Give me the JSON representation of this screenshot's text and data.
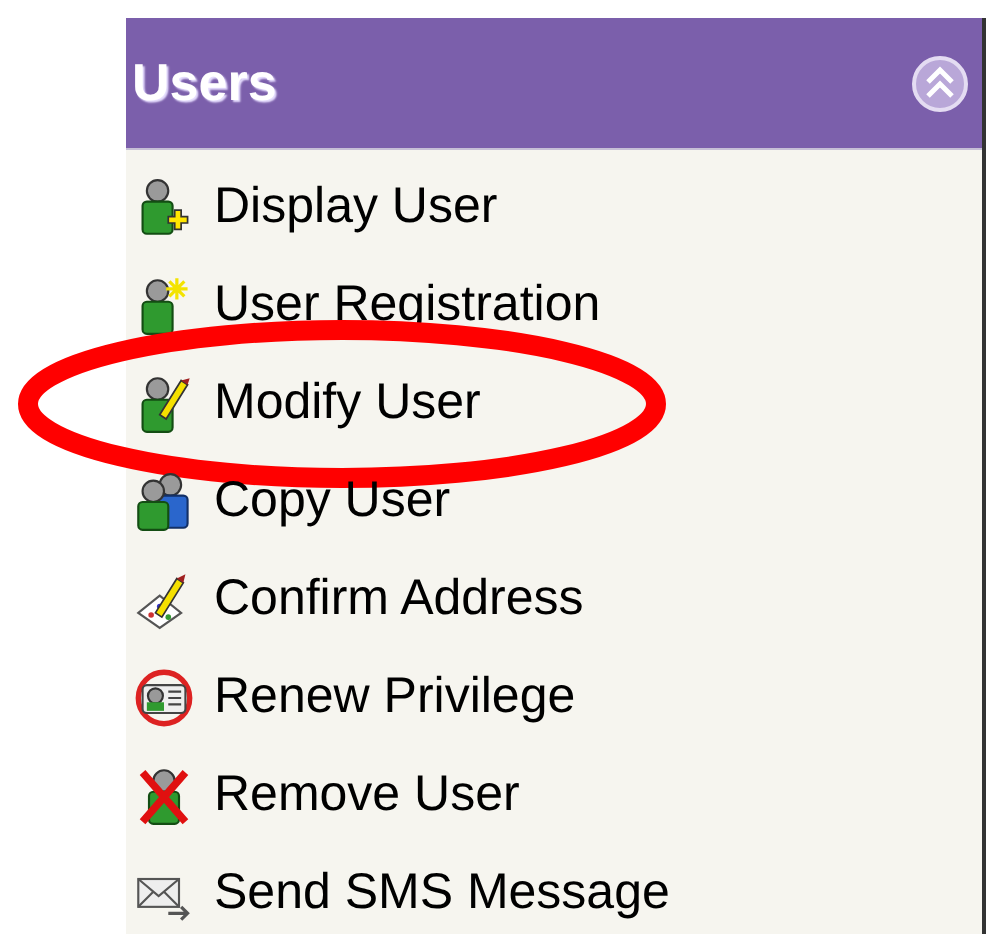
{
  "panel": {
    "title": "Users",
    "expanded": true
  },
  "items": [
    {
      "label": "Display User",
      "kind": "display",
      "highlighted": false
    },
    {
      "label": "User Registration",
      "kind": "register",
      "highlighted": false
    },
    {
      "label": "Modify User",
      "kind": "modify",
      "highlighted": true
    },
    {
      "label": "Copy User",
      "kind": "copy",
      "highlighted": false
    },
    {
      "label": "Confirm Address",
      "kind": "confirm",
      "highlighted": false
    },
    {
      "label": "Renew Privilege",
      "kind": "renew",
      "highlighted": false
    },
    {
      "label": "Remove User",
      "kind": "remove",
      "highlighted": false
    },
    {
      "label": "Send SMS Message",
      "kind": "sms",
      "highlighted": false
    }
  ]
}
